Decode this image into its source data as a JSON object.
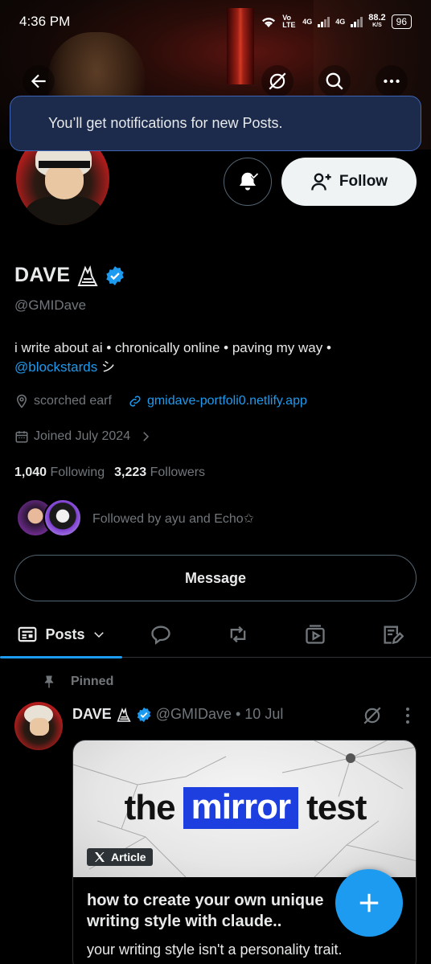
{
  "status_bar": {
    "time": "4:36 PM",
    "network_1": "Vo LTE",
    "network_2": "4G",
    "network_3": "4G",
    "speed": "88.2",
    "speed_unit": "K/S",
    "battery": "96"
  },
  "toast": {
    "text": "You’ll get notifications for new Posts."
  },
  "profile": {
    "follow_label": "Follow",
    "name": "DAVE",
    "handle": "@GMIDave",
    "bio_line1": "i write about ai • chronically online • paving my way •",
    "bio_link": "@blockstards",
    "bio_end": " シ",
    "location": "scorched earf",
    "website": "gmidave-portfoli0.netlify.app",
    "joined": "Joined July 2024",
    "following_count": "1,040",
    "following_label": "Following",
    "followers_count": "3,223",
    "followers_label": "Followers",
    "followed_by": "Followed by ayu and Echo✩",
    "message_label": "Message"
  },
  "tabs": {
    "posts_label": "Posts"
  },
  "pinned_post": {
    "pinned_label": "Pinned",
    "author_name": "DAVE",
    "author_handle": "@GMIDave",
    "separator": "•",
    "date": "10 Jul",
    "card_title_pre": "the",
    "card_title_highlight": "mirror",
    "card_title_post": "test",
    "article_badge": "Article",
    "headline": "how to create your own unique writing style with claude..",
    "subtext": "your writing style isn't a personality trait."
  },
  "colors": {
    "accent": "#1d9bf0",
    "toast_bg": "#1c2a4b",
    "toast_border": "#3e64b5",
    "secondary_text": "#71767b",
    "card_highlight": "#1d3fe0"
  },
  "icons": [
    "back-arrow-icon",
    "grok-icon",
    "search-icon",
    "more-icon",
    "bell-icon",
    "add-user-icon",
    "verified-icon",
    "owl-emoji-icon",
    "location-icon",
    "link-icon",
    "calendar-icon",
    "chevron-right-icon",
    "posts-icon",
    "chevron-down-icon",
    "reply-icon",
    "repost-icon",
    "media-icon",
    "articles-icon",
    "pin-icon",
    "plus-icon",
    "x-logo-icon"
  ]
}
